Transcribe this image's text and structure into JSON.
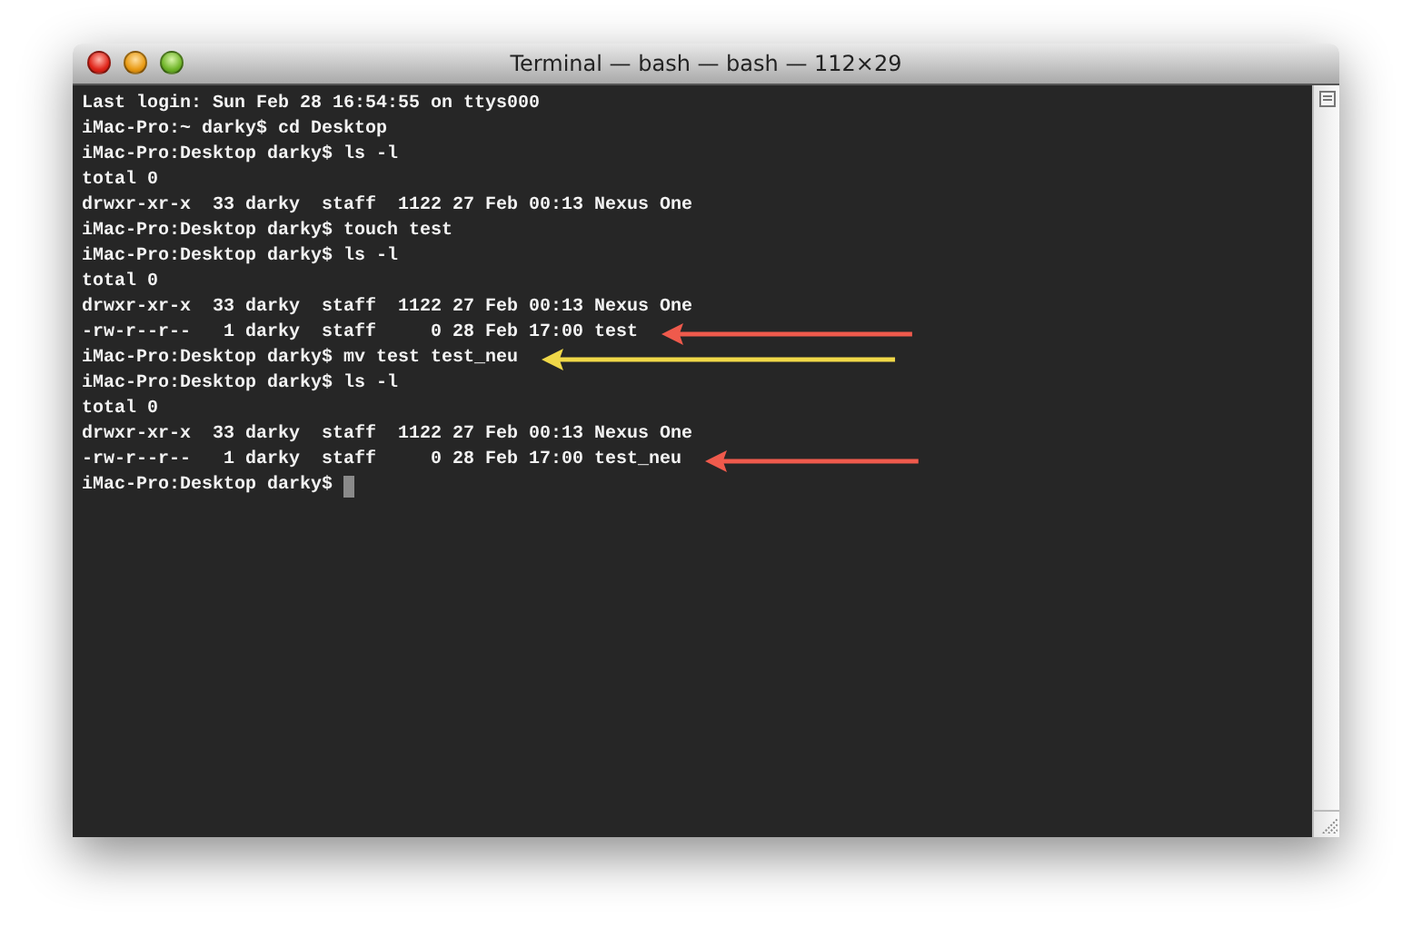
{
  "window": {
    "title": "Terminal — bash — bash — 112×29"
  },
  "terminal": {
    "cursor_visible": true,
    "lines": [
      {
        "text": "Last login: Sun Feb 28 16:54:55 on ttys000"
      },
      {
        "text": "iMac-Pro:~ darky$ cd Desktop"
      },
      {
        "text": "iMac-Pro:Desktop darky$ ls -l"
      },
      {
        "text": "total 0"
      },
      {
        "text": "drwxr-xr-x  33 darky  staff  1122 27 Feb 00:13 Nexus One"
      },
      {
        "text": "iMac-Pro:Desktop darky$ touch test"
      },
      {
        "text": "iMac-Pro:Desktop darky$ ls -l"
      },
      {
        "text": "total 0"
      },
      {
        "text": "drwxr-xr-x  33 darky  staff  1122 27 Feb 00:13 Nexus One"
      },
      {
        "text": "-rw-r--r--   1 darky  staff     0 28 Feb 17:00 test",
        "arrow": {
          "color": "#ef5a4c"
        }
      },
      {
        "text": "iMac-Pro:Desktop darky$ mv test test_neu",
        "arrow": {
          "color": "#f0d848"
        }
      },
      {
        "text": "iMac-Pro:Desktop darky$ ls -l"
      },
      {
        "text": "total 0"
      },
      {
        "text": "drwxr-xr-x  33 darky  staff  1122 27 Feb 00:13 Nexus One"
      },
      {
        "text": "-rw-r--r--   1 darky  staff     0 28 Feb 17:00 test_neu",
        "arrow": {
          "color": "#ef5a4c"
        }
      },
      {
        "text": "iMac-Pro:Desktop darky$"
      }
    ]
  }
}
